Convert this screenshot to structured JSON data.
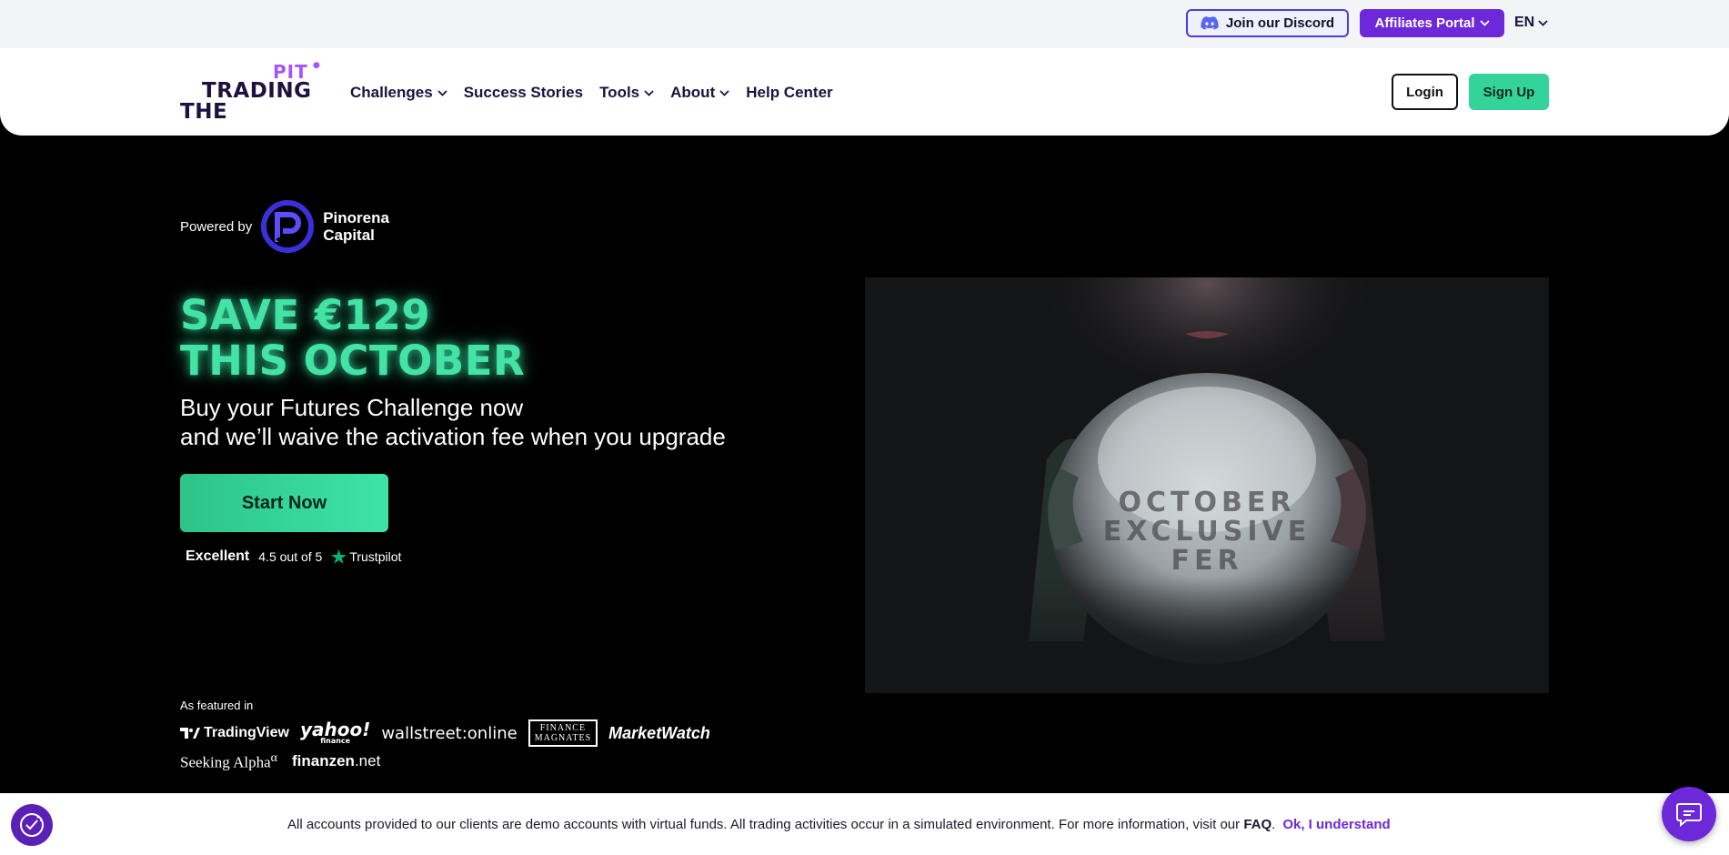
{
  "topbar": {
    "discord_label": "Join our Discord",
    "affiliates_label": "Affiliates Portal",
    "language": "EN"
  },
  "header": {
    "logo": {
      "line1": "PIT",
      "line2": "TRADING",
      "line3": "THE"
    },
    "nav": [
      "Challenges",
      "Success Stories",
      "Tools",
      "About",
      "Help Center"
    ],
    "login_label": "Login",
    "signup_label": "Sign Up"
  },
  "hero": {
    "powered_by": "Powered by",
    "partner_line1": "Pinorena",
    "partner_line2": "Capital",
    "headline_line1": "SAVE €129",
    "headline_line2": "THIS OCTOBER",
    "sub_line1": "Buy your Futures Challenge now",
    "sub_line2": "and we’ll waive the activation fee when you upgrade",
    "cta_label": "Start Now",
    "trust_rating": "Excellent",
    "trust_score": "4.5 out of 5",
    "trust_brand": "Trustpilot",
    "image_text_line1": "OCTOBER",
    "image_text_line2": "EXCLUSIVE",
    "image_text_line3": "FER"
  },
  "featured": {
    "label": "As featured in",
    "tradingview": "TradingView",
    "yahoo": "yahoo!",
    "yahoo_sub": "finance",
    "wallstreet": "wallstreet:online",
    "finance_magnates_1": "FINANCE",
    "finance_magnates_2": "MAGNATES",
    "marketwatch": "MarketWatch",
    "seeking_alpha": "Seeking Alpha",
    "seeking_alpha_mark": "α",
    "finanzen": "finanzen",
    "finanzen_suffix": ".net"
  },
  "notice": {
    "text": "All accounts provided to our clients are demo accounts with virtual funds. All trading activities occur in a simulated environment. For more information, visit our ",
    "faq": "FAQ",
    "period": ".",
    "ok_label": "Ok, I understand"
  },
  "colors": {
    "brand_purple": "#6d28d9",
    "accent_green": "#34d399",
    "headline_green": "#43e3a6",
    "dark_text": "#1d1140"
  }
}
